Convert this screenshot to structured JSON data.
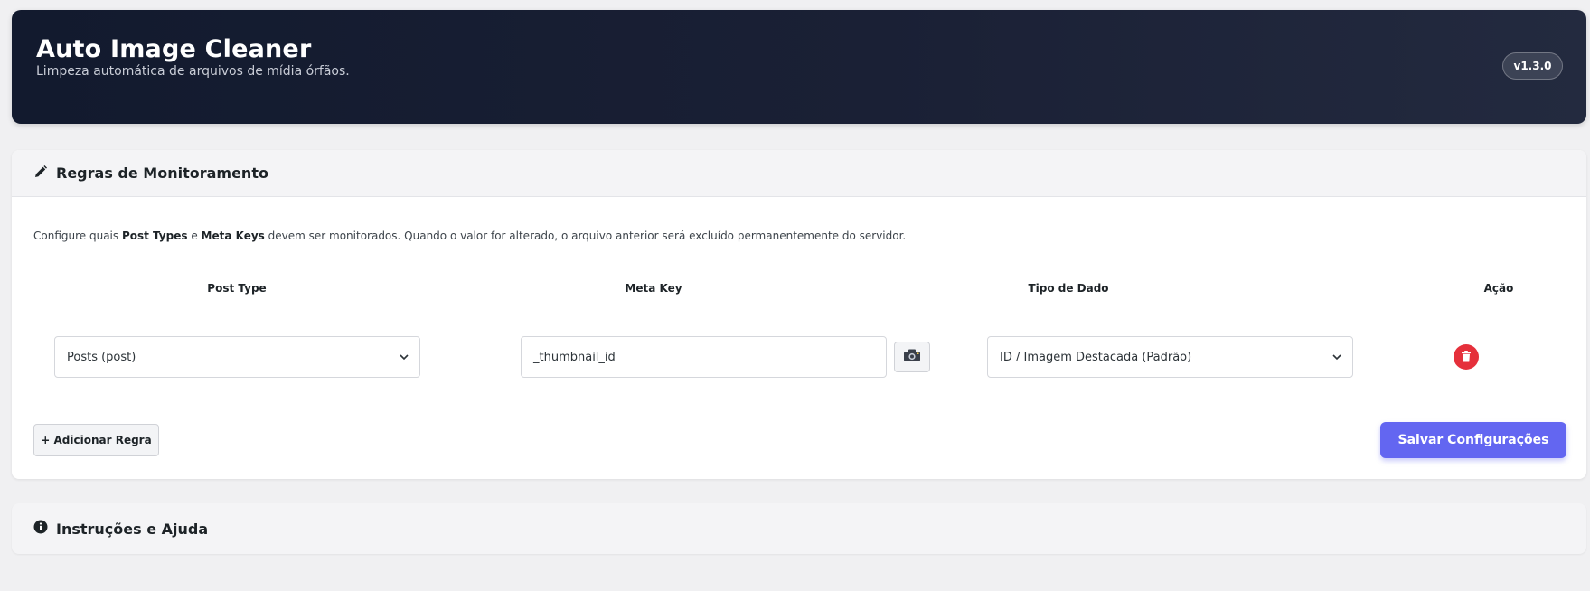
{
  "header": {
    "title": "Auto Image Cleaner",
    "subtitle": "Limpeza automática de arquivos de mídia órfãos.",
    "version": "v1.3.0",
    "background_color": "#121a2e"
  },
  "rules_panel": {
    "title": "Regras de Monitoramento",
    "icon": "pencil-icon",
    "description": {
      "part1": "Configure quais ",
      "bold1": "Post Types",
      "part2": " e ",
      "bold2": "Meta Keys",
      "part3": " devem ser monitorados. Quando o valor for alterado, o arquivo anterior será excluído permanentemente do servidor."
    },
    "columns": {
      "post_type": "Post Type",
      "meta_key": "Meta Key",
      "data_type": "Tipo de Dado",
      "action": "Ação"
    },
    "rules": [
      {
        "post_type": "Posts (post)",
        "meta_key": "_thumbnail_id",
        "data_type": "ID / Imagem Destacada (Padrão)",
        "media_button_icon": "camera-icon",
        "delete_icon": "trash-icon"
      }
    ],
    "add_rule_label": "+ Adicionar Regra",
    "save_label": "Salvar Configurações",
    "accent_color": "#6366f1",
    "danger_color": "#e5303b"
  },
  "help_panel": {
    "title": "Instruções e Ajuda",
    "icon": "info-icon"
  }
}
